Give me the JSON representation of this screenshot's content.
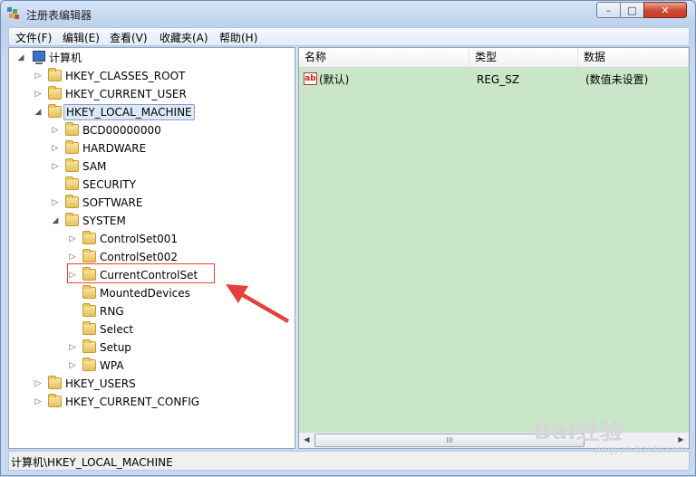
{
  "window": {
    "title": "注册表编辑器",
    "min_glyph": "–",
    "max_glyph": "□",
    "close_glyph": "✕"
  },
  "menu": {
    "items": [
      {
        "label": "文件(F)"
      },
      {
        "label": "编辑(E)"
      },
      {
        "label": "查看(V)"
      },
      {
        "label": "收藏夹(A)"
      },
      {
        "label": "帮助(H)"
      }
    ]
  },
  "tree": {
    "root": "计算机",
    "nodes": [
      {
        "label": "HKEY_CLASSES_ROOT",
        "expander": "▷"
      },
      {
        "label": "HKEY_CURRENT_USER",
        "expander": "▷"
      },
      {
        "label": "HKEY_LOCAL_MACHINE",
        "expander": "◢"
      },
      {
        "label": "BCD00000000",
        "expander": "▷"
      },
      {
        "label": "HARDWARE",
        "expander": "▷"
      },
      {
        "label": "SAM",
        "expander": "▷"
      },
      {
        "label": "SECURITY",
        "expander": ""
      },
      {
        "label": "SOFTWARE",
        "expander": "▷"
      },
      {
        "label": "SYSTEM",
        "expander": "◢"
      },
      {
        "label": "ControlSet001",
        "expander": "▷"
      },
      {
        "label": "ControlSet002",
        "expander": "▷"
      },
      {
        "label": "CurrentControlSet",
        "expander": "▷"
      },
      {
        "label": "MountedDevices",
        "expander": ""
      },
      {
        "label": "RNG",
        "expander": ""
      },
      {
        "label": "Select",
        "expander": ""
      },
      {
        "label": "Setup",
        "expander": "▷"
      },
      {
        "label": "WPA",
        "expander": "▷"
      },
      {
        "label": "HKEY_USERS",
        "expander": "▷"
      },
      {
        "label": "HKEY_CURRENT_CONFIG",
        "expander": "▷"
      }
    ]
  },
  "list": {
    "headers": {
      "name": "名称",
      "type": "类型",
      "data": "数据"
    },
    "rows": [
      {
        "icon": "ab",
        "name": "(默认)",
        "type": "REG_SZ",
        "data": "(数值未设置)"
      }
    ],
    "scroll_left": "◀",
    "scroll_right": "▶",
    "scroll_grip": "III"
  },
  "status": {
    "path": "计算机\\HKEY_LOCAL_MACHINE"
  },
  "watermark": {
    "main": "Bai经验",
    "sub": "jingyan.baidu.com"
  },
  "colors": {
    "list_bg": "#c9e6c9",
    "highlight_box": "#e3413a",
    "arrow": "#e3413a"
  }
}
